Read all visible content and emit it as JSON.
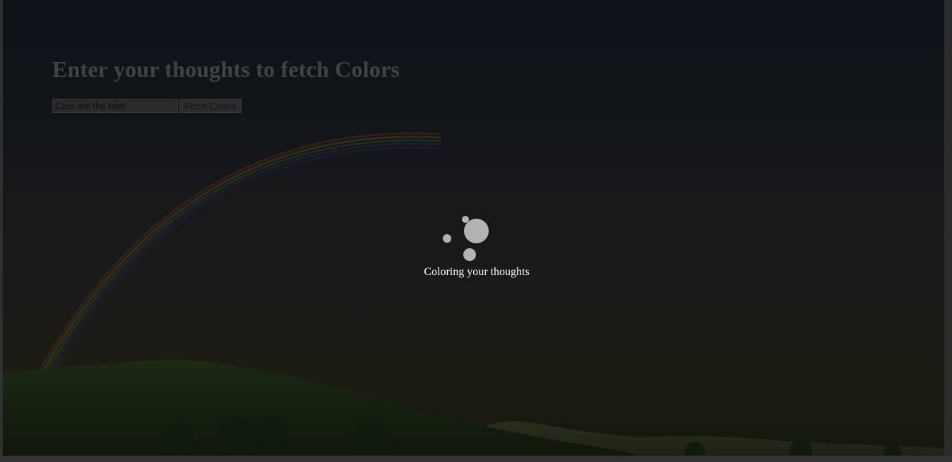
{
  "page": {
    "heading": "Enter your thoughts to fetch Colors"
  },
  "form": {
    "input_value": "Cars are the best",
    "button_label": "Fetch Colors"
  },
  "loader": {
    "message": "Coloring your thoughts"
  },
  "colors": {
    "overlay": "#000000",
    "loader_dot": "#b3b3b3",
    "loader_text": "#ffffff",
    "rainbow_visible": true
  }
}
